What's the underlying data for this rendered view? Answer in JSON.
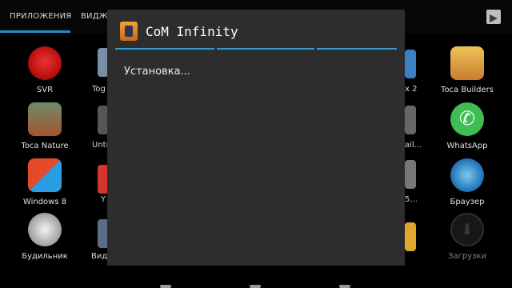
{
  "tabs": [
    {
      "label": "ПРИЛОЖЕНИЯ"
    },
    {
      "label": "ВИДЖ"
    }
  ],
  "apps": [
    {
      "label": "SVR",
      "icon": "svr-icon"
    },
    {
      "label": "Tog",
      "icon": "app-icon"
    },
    {
      "label": "x 2",
      "icon": "app-icon"
    },
    {
      "label": "Toca Builders",
      "icon": "toca-builders-icon"
    },
    {
      "label": "Toca Nature",
      "icon": "toca-nature-icon"
    },
    {
      "label": "Untu",
      "icon": "app-icon"
    },
    {
      "label": "ail...",
      "icon": "app-icon"
    },
    {
      "label": "WhatsApp",
      "icon": "whatsapp-icon"
    },
    {
      "label": "Windows 8",
      "icon": "windows-8-icon"
    },
    {
      "label": "Y",
      "icon": "app-icon"
    },
    {
      "label": "5...",
      "icon": "app-icon"
    },
    {
      "label": "Браузер",
      "icon": "browser-icon"
    },
    {
      "label": "Будильник",
      "icon": "alarm-clock-icon"
    },
    {
      "label": "Вид",
      "icon": "app-icon"
    },
    {
      "label": "Загрузки",
      "icon": "downloads-icon"
    }
  ],
  "dialog": {
    "title": "CoM Infinity",
    "message": "Установка..."
  }
}
